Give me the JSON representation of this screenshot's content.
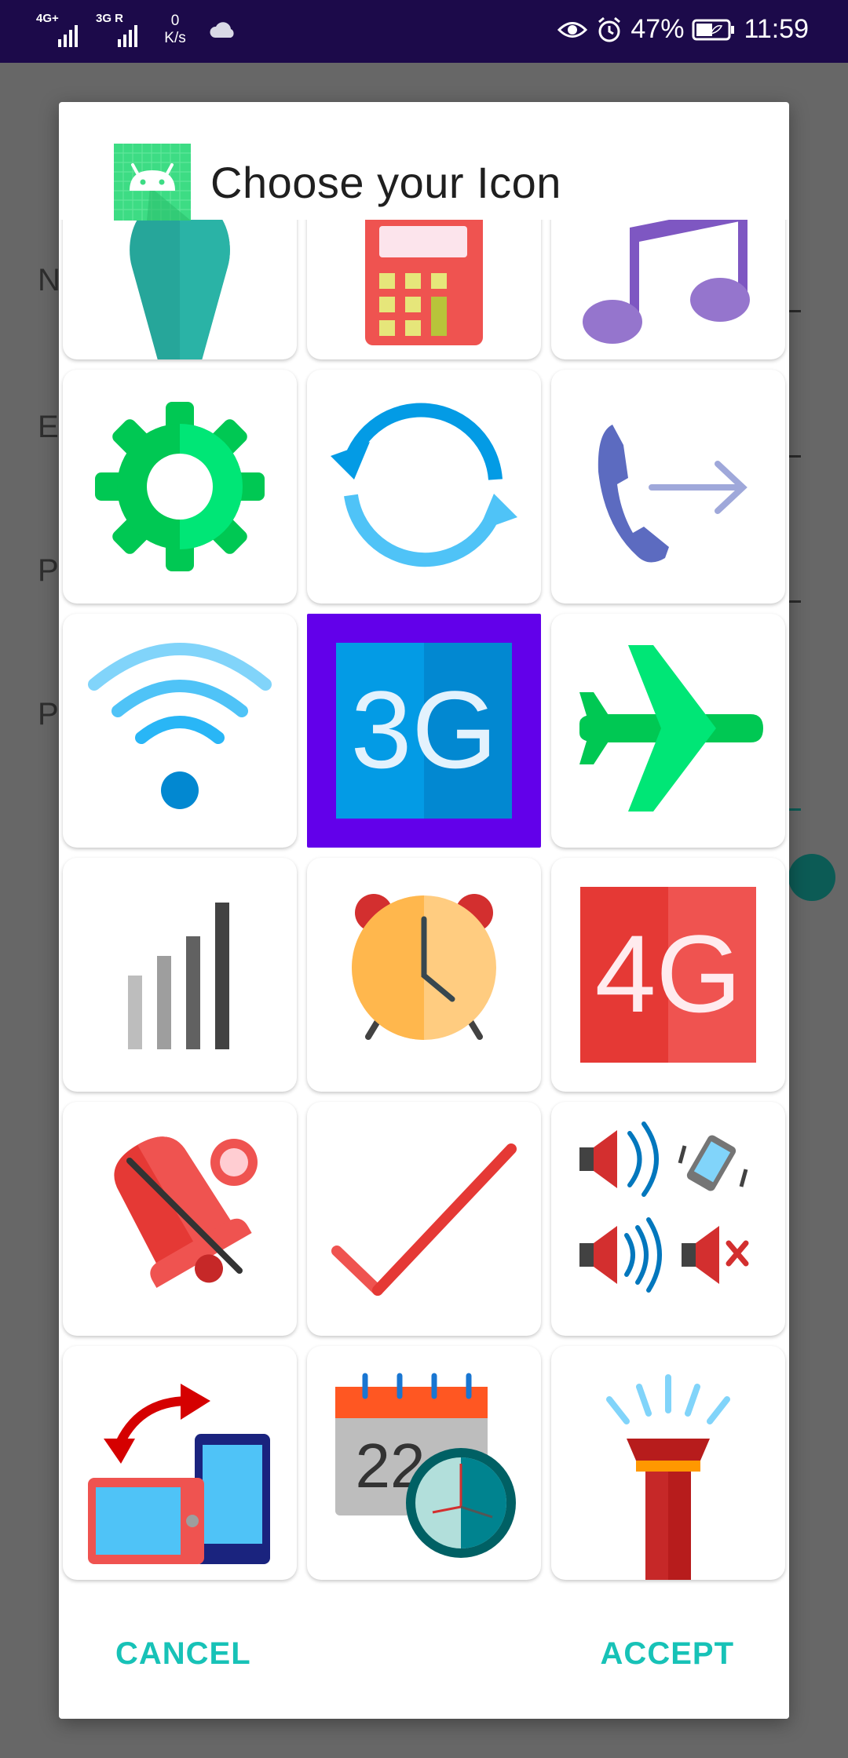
{
  "status_bar": {
    "network1": "4G+",
    "network2": "3G R",
    "speed_value": "0",
    "speed_unit": "K/s",
    "battery": "47%",
    "time": "11:59"
  },
  "background": {
    "field_initials": [
      "N",
      "E",
      "P",
      "P"
    ]
  },
  "dialog": {
    "title": "Choose your Icon",
    "cancel_label": "CANCEL",
    "accept_label": "ACCEPT",
    "selected_icon": "3g-icon",
    "icons": [
      "location-pin-icon",
      "calculator-icon",
      "music-note-icon",
      "settings-gear-icon",
      "sync-icon",
      "call-forward-icon",
      "wifi-icon",
      "3g-icon",
      "airplane-mode-icon",
      "signal-bars-icon",
      "alarm-clock-icon",
      "4g-icon",
      "bell-off-icon",
      "checkmark-icon",
      "sound-profile-icon",
      "screen-rotation-icon",
      "calendar-clock-icon",
      "flashlight-icon"
    ],
    "tile_texts": {
      "3g": "3G",
      "4g": "4G",
      "calendar_day": "22"
    }
  },
  "colors": {
    "accent": "#17c2b7",
    "selection": "#6200ea",
    "status_bar": "#1c0a4a"
  }
}
